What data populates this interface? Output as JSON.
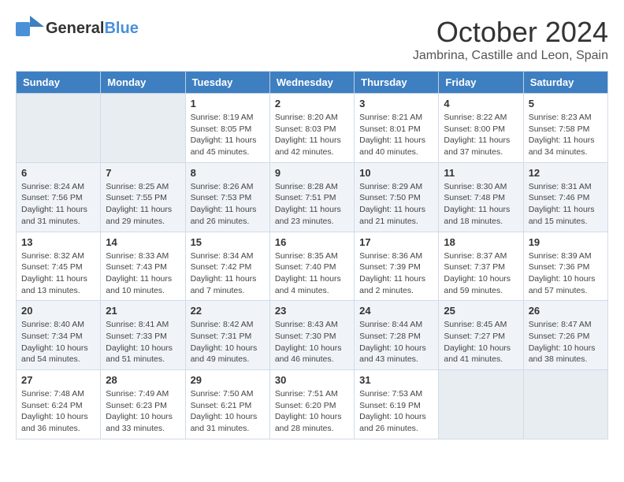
{
  "header": {
    "logo_general": "General",
    "logo_blue": "Blue",
    "month": "October 2024",
    "location": "Jambrina, Castille and Leon, Spain"
  },
  "days_of_week": [
    "Sunday",
    "Monday",
    "Tuesday",
    "Wednesday",
    "Thursday",
    "Friday",
    "Saturday"
  ],
  "weeks": [
    [
      {
        "day": "",
        "empty": true
      },
      {
        "day": "",
        "empty": true
      },
      {
        "day": "1",
        "sunrise": "8:19 AM",
        "sunset": "8:05 PM",
        "daylight": "11 hours and 45 minutes."
      },
      {
        "day": "2",
        "sunrise": "8:20 AM",
        "sunset": "8:03 PM",
        "daylight": "11 hours and 42 minutes."
      },
      {
        "day": "3",
        "sunrise": "8:21 AM",
        "sunset": "8:01 PM",
        "daylight": "11 hours and 40 minutes."
      },
      {
        "day": "4",
        "sunrise": "8:22 AM",
        "sunset": "8:00 PM",
        "daylight": "11 hours and 37 minutes."
      },
      {
        "day": "5",
        "sunrise": "8:23 AM",
        "sunset": "7:58 PM",
        "daylight": "11 hours and 34 minutes."
      }
    ],
    [
      {
        "day": "6",
        "sunrise": "8:24 AM",
        "sunset": "7:56 PM",
        "daylight": "11 hours and 31 minutes."
      },
      {
        "day": "7",
        "sunrise": "8:25 AM",
        "sunset": "7:55 PM",
        "daylight": "11 hours and 29 minutes."
      },
      {
        "day": "8",
        "sunrise": "8:26 AM",
        "sunset": "7:53 PM",
        "daylight": "11 hours and 26 minutes."
      },
      {
        "day": "9",
        "sunrise": "8:28 AM",
        "sunset": "7:51 PM",
        "daylight": "11 hours and 23 minutes."
      },
      {
        "day": "10",
        "sunrise": "8:29 AM",
        "sunset": "7:50 PM",
        "daylight": "11 hours and 21 minutes."
      },
      {
        "day": "11",
        "sunrise": "8:30 AM",
        "sunset": "7:48 PM",
        "daylight": "11 hours and 18 minutes."
      },
      {
        "day": "12",
        "sunrise": "8:31 AM",
        "sunset": "7:46 PM",
        "daylight": "11 hours and 15 minutes."
      }
    ],
    [
      {
        "day": "13",
        "sunrise": "8:32 AM",
        "sunset": "7:45 PM",
        "daylight": "11 hours and 13 minutes."
      },
      {
        "day": "14",
        "sunrise": "8:33 AM",
        "sunset": "7:43 PM",
        "daylight": "11 hours and 10 minutes."
      },
      {
        "day": "15",
        "sunrise": "8:34 AM",
        "sunset": "7:42 PM",
        "daylight": "11 hours and 7 minutes."
      },
      {
        "day": "16",
        "sunrise": "8:35 AM",
        "sunset": "7:40 PM",
        "daylight": "11 hours and 4 minutes."
      },
      {
        "day": "17",
        "sunrise": "8:36 AM",
        "sunset": "7:39 PM",
        "daylight": "11 hours and 2 minutes."
      },
      {
        "day": "18",
        "sunrise": "8:37 AM",
        "sunset": "7:37 PM",
        "daylight": "10 hours and 59 minutes."
      },
      {
        "day": "19",
        "sunrise": "8:39 AM",
        "sunset": "7:36 PM",
        "daylight": "10 hours and 57 minutes."
      }
    ],
    [
      {
        "day": "20",
        "sunrise": "8:40 AM",
        "sunset": "7:34 PM",
        "daylight": "10 hours and 54 minutes."
      },
      {
        "day": "21",
        "sunrise": "8:41 AM",
        "sunset": "7:33 PM",
        "daylight": "10 hours and 51 minutes."
      },
      {
        "day": "22",
        "sunrise": "8:42 AM",
        "sunset": "7:31 PM",
        "daylight": "10 hours and 49 minutes."
      },
      {
        "day": "23",
        "sunrise": "8:43 AM",
        "sunset": "7:30 PM",
        "daylight": "10 hours and 46 minutes."
      },
      {
        "day": "24",
        "sunrise": "8:44 AM",
        "sunset": "7:28 PM",
        "daylight": "10 hours and 43 minutes."
      },
      {
        "day": "25",
        "sunrise": "8:45 AM",
        "sunset": "7:27 PM",
        "daylight": "10 hours and 41 minutes."
      },
      {
        "day": "26",
        "sunrise": "8:47 AM",
        "sunset": "7:26 PM",
        "daylight": "10 hours and 38 minutes."
      }
    ],
    [
      {
        "day": "27",
        "sunrise": "7:48 AM",
        "sunset": "6:24 PM",
        "daylight": "10 hours and 36 minutes."
      },
      {
        "day": "28",
        "sunrise": "7:49 AM",
        "sunset": "6:23 PM",
        "daylight": "10 hours and 33 minutes."
      },
      {
        "day": "29",
        "sunrise": "7:50 AM",
        "sunset": "6:21 PM",
        "daylight": "10 hours and 31 minutes."
      },
      {
        "day": "30",
        "sunrise": "7:51 AM",
        "sunset": "6:20 PM",
        "daylight": "10 hours and 28 minutes."
      },
      {
        "day": "31",
        "sunrise": "7:53 AM",
        "sunset": "6:19 PM",
        "daylight": "10 hours and 26 minutes."
      },
      {
        "day": "",
        "empty": true
      },
      {
        "day": "",
        "empty": true
      }
    ]
  ]
}
